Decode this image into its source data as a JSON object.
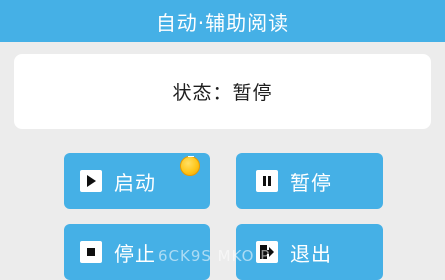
{
  "title": "自动·辅助阅读",
  "status": {
    "text": "状态：暂停"
  },
  "buttons": {
    "start": {
      "label": "启动",
      "icon": "play-icon"
    },
    "pause": {
      "label": "暂停",
      "icon": "pause-icon"
    },
    "stop": {
      "label": "停止",
      "icon": "stop-icon"
    },
    "exit": {
      "label": "退出",
      "icon": "exit-icon"
    }
  },
  "watermark": "6CK9S MKO P",
  "colors": {
    "accent": "#45b0e6",
    "background": "#ececec",
    "card": "#ffffff",
    "coin": "#ffc61a"
  }
}
